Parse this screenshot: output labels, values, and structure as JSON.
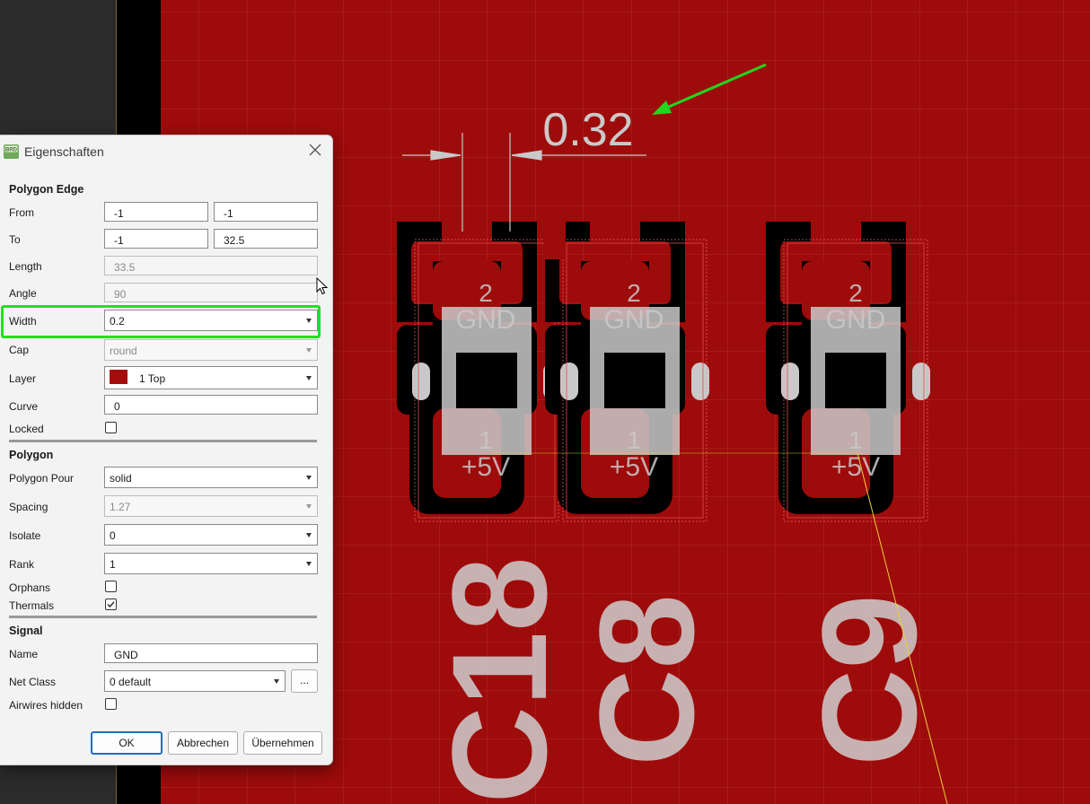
{
  "canvas": {
    "dimension_value": "0.32",
    "pads": [
      {
        "top_number": "2",
        "top_net": "GND",
        "bottom_number": "1",
        "bottom_net": "+5V",
        "ref": "C18"
      },
      {
        "top_number": "2",
        "top_net": "GND",
        "bottom_number": "1",
        "bottom_net": "+5V",
        "ref": "C8"
      },
      {
        "top_number": "2",
        "top_net": "GND",
        "bottom_number": "1",
        "bottom_net": "+5V",
        "ref": "C9"
      }
    ],
    "colors": {
      "board": "#9e0b0b",
      "copper_clear": "#000000",
      "silk": "#c9c9c9",
      "arrow": "#22d61f"
    }
  },
  "dialog": {
    "title": "Eigenschaften",
    "sections": {
      "edge": "Polygon Edge",
      "polygon": "Polygon",
      "signal": "Signal"
    },
    "edge": {
      "from_label": "From",
      "from_x": "-1",
      "from_y": "-1",
      "to_label": "To",
      "to_x": "-1",
      "to_y": "32.5",
      "length_label": "Length",
      "length_value": "33.5",
      "angle_label": "Angle",
      "angle_value": "90",
      "width_label": "Width",
      "width_value": "0.2",
      "cap_label": "Cap",
      "cap_value": "round",
      "layer_label": "Layer",
      "layer_value": "1 Top",
      "curve_label": "Curve",
      "curve_value": "0",
      "locked_label": "Locked",
      "locked_checked": false
    },
    "polygon": {
      "pour_label": "Polygon Pour",
      "pour_value": "solid",
      "spacing_label": "Spacing",
      "spacing_value": "1.27",
      "isolate_label": "Isolate",
      "isolate_value": "0",
      "rank_label": "Rank",
      "rank_value": "1",
      "orphans_label": "Orphans",
      "orphans_checked": false,
      "thermals_label": "Thermals",
      "thermals_checked": true
    },
    "signal": {
      "name_label": "Name",
      "name_value": "GND",
      "netclass_label": "Net Class",
      "netclass_value": "0 default",
      "netclass_button": "...",
      "airwires_label": "Airwires hidden",
      "airwires_checked": false
    },
    "buttons": {
      "ok": "OK",
      "cancel": "Abbrechen",
      "apply": "Übernehmen"
    },
    "app_icon_text": "BRD"
  }
}
